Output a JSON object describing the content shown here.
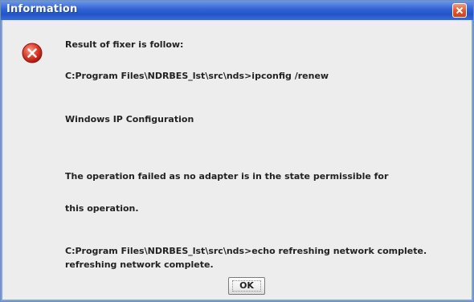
{
  "window": {
    "title": "Information",
    "close_icon": "close-icon"
  },
  "dialog": {
    "icon": "error-icon",
    "lines": [
      "Result of fixer is follow:",
      "C:Program Files\\NDRBES_lst\\src\\nds>ipconfig /renew",
      "Windows IP Configuration",
      "The operation failed as no adapter is in the state permissible for",
      "this operation.",
      "C:Program Files\\NDRBES_lst\\src\\nds>echo refreshing network complete.",
      "refreshing network complete."
    ]
  },
  "buttons": {
    "ok_label": "OK"
  },
  "colors": {
    "titlebar": "#2f62d4",
    "close": "#e0552c",
    "error_red": "#d82a1e",
    "background": "#ededed"
  }
}
